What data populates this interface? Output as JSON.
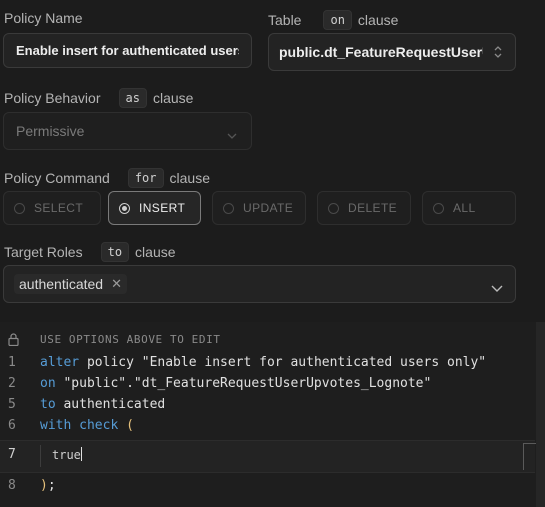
{
  "policy_name": {
    "label": "Policy Name",
    "value": "Enable insert for authenticated users only"
  },
  "table": {
    "label": "Table",
    "chip": "on",
    "clause": "clause",
    "value": "public.dt_FeatureRequestUserUpvotes_Lognote"
  },
  "behavior": {
    "label": "Policy Behavior",
    "chip": "as",
    "clause": "clause",
    "value": "Permissive"
  },
  "command": {
    "label": "Policy Command",
    "chip": "for",
    "clause": "clause",
    "options": [
      "SELECT",
      "INSERT",
      "UPDATE",
      "DELETE",
      "ALL"
    ],
    "selected": "INSERT"
  },
  "roles": {
    "label": "Target Roles",
    "chip": "to",
    "clause": "clause",
    "tag": "authenticated"
  },
  "editor": {
    "notice": "USE OPTIONS ABOVE TO EDIT",
    "line_numbers": [
      "1",
      "2",
      "5",
      "6",
      "7",
      "8"
    ],
    "line1_kw": "alter",
    "line1_rest": " policy \"Enable insert for authenticated users only\"",
    "line2_kw": "on",
    "line2_rest": " \"public\".\"dt_FeatureRequestUserUpvotes_Lognote\"",
    "line5_kw": "to",
    "line5_rest": " authenticated",
    "line6_kw": "with check",
    "line6_brace": "(",
    "line7": "true",
    "line8_brace": ")",
    "line8_rest": ";"
  }
}
